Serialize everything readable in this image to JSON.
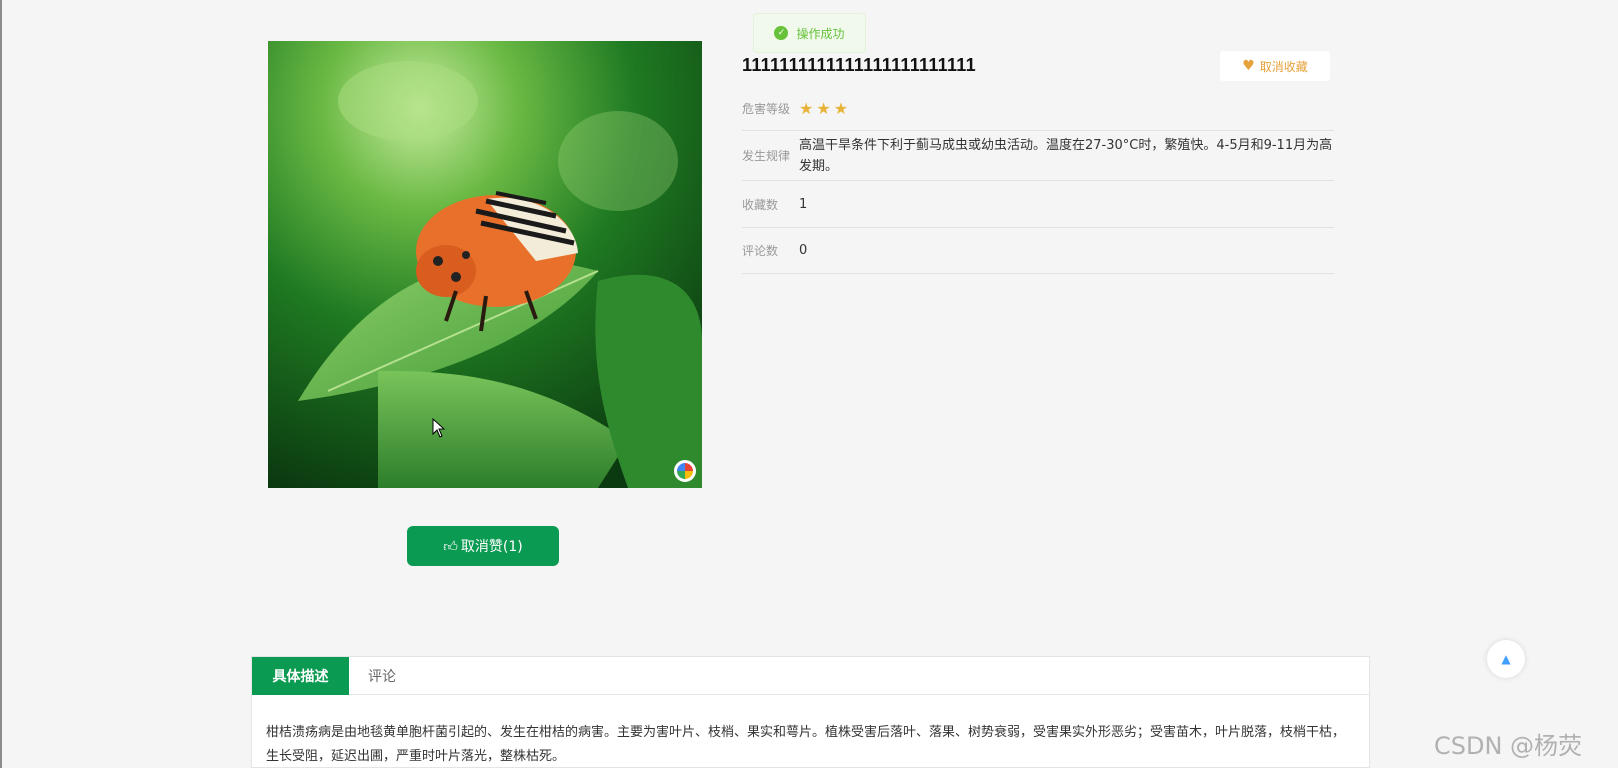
{
  "toast": {
    "message": "操作成功",
    "icon": "check-circle-icon",
    "color": "#67c23a"
  },
  "pest": {
    "title": "1111111111111111111111111",
    "unfavorite_label": "取消收藏",
    "level_label": "危害等级",
    "level_stars": 3,
    "pattern_label": "发生规律",
    "pattern_value": "高温干旱条件下利于蓟马成虫或幼虫活动。温度在27-30°C时，繁殖快。4-5月和9-11月为高发期。",
    "fav_count_label": "收藏数",
    "fav_count": "1",
    "comment_count_label": "评论数",
    "comment_count": "0"
  },
  "like_button": {
    "label": "取消赞(1)",
    "icon": "thumbs-up-icon"
  },
  "tabs": [
    {
      "label": "具体描述",
      "active": true
    },
    {
      "label": "评论",
      "active": false
    }
  ],
  "description": "柑桔溃疡病是由地毯黄单胞杆菌引起的、发生在柑桔的病害。主要为害叶片、枝梢、果实和萼片。植株受害后落叶、落果、树势衰弱，受害果实外形恶劣；受害苗木，叶片脱落，枝梢干枯，生长受阻，延迟出圃，严重时叶片落光，整株枯死。",
  "watermark": "CSDN @杨荧",
  "colors": {
    "primary": "#0b9a52",
    "warning": "#e6a23c",
    "star": "#e8b339"
  }
}
